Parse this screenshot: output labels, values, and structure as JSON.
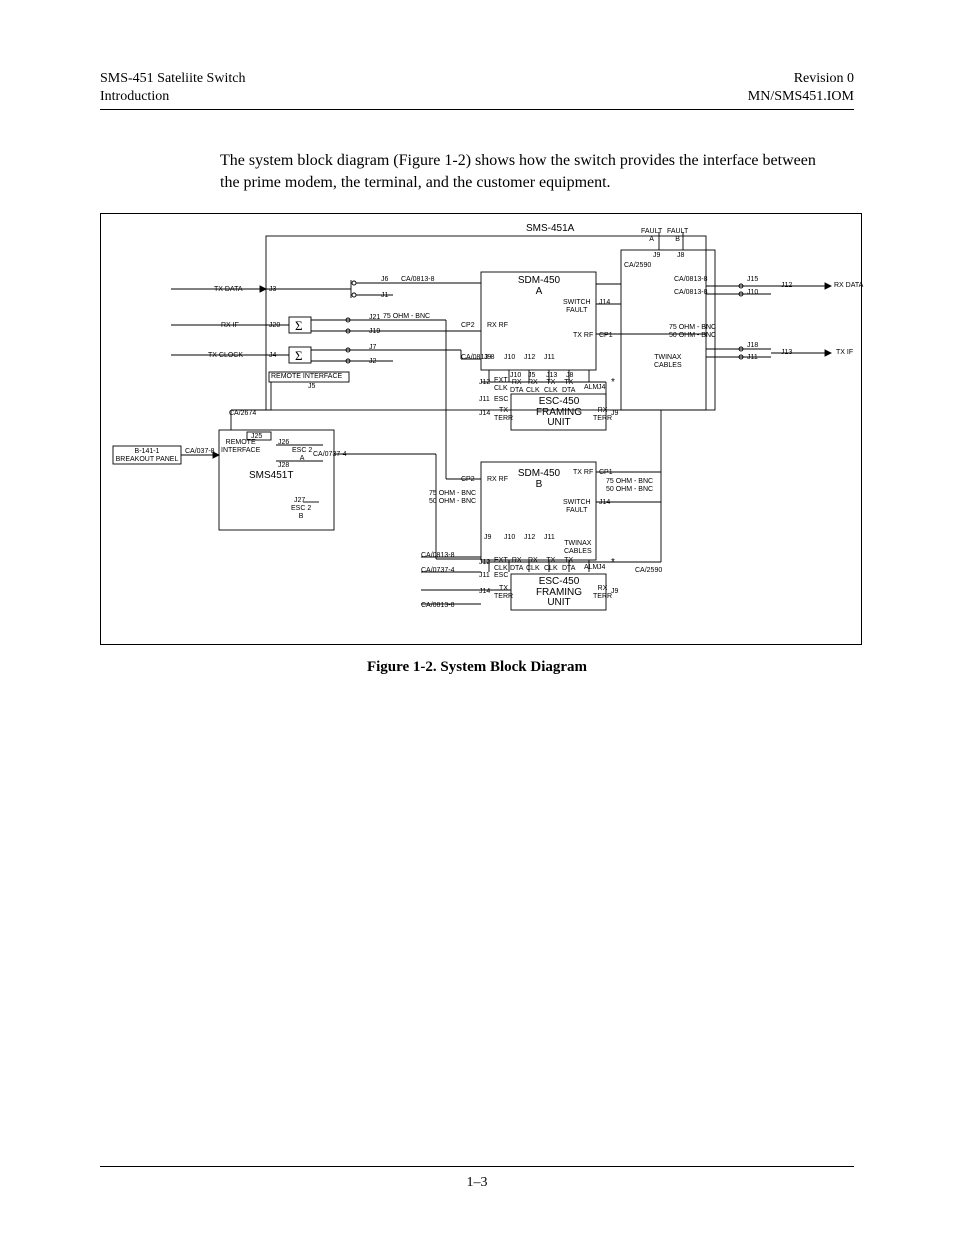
{
  "header": {
    "left1": "SMS-451 Sateliite Switch",
    "left2": "Introduction",
    "right1": "Revision 0",
    "right2": "MN/SMS451.IOM"
  },
  "body": "The system block diagram (Figure 1-2) shows how the switch provides the interface between the prime modem, the terminal, and the customer equipment.",
  "caption": "Figure 1-2.  System Block Diagram",
  "pagenum": "1–3",
  "diagram": {
    "title": "SMS-451A",
    "modemA": "SDM-450\nA",
    "modemB": "SDM-450\nB",
    "framingA": "ESC-450\nFRAMING\nUNIT",
    "framingB": "ESC-450\nFRAMING\nUNIT",
    "breakout": "B-141-1\nBREAKOUT PANEL",
    "sms451t": "SMS451T",
    "io": {
      "txData": "TX DATA",
      "rxIf": "RX IF",
      "txClock": "TX CLOCK",
      "rxData": "RX DATA",
      "txIf": "TX IF"
    },
    "fault": {
      "a": "FAULT\nA",
      "b": "FAULT\nB"
    },
    "remoteIfA": "REMOTE INTERFACE",
    "remoteIfB": "REMOTE\nINTERFACE",
    "cables": {
      "ca0813_8": "CA/0813-8",
      "ca2590": "CA/2590",
      "ca2674": "CA/2674",
      "ca0737_4": "CA/0737-4",
      "ca037_8": "CA/037-8"
    },
    "ohm": {
      "bnc": "75 OHM - BNC",
      "dual": "75 OHM - BNC\n50 OHM - BNC"
    },
    "esc2a": "ESC 2\nA",
    "esc2b": "ESC 2\nB",
    "switchFault": "SWITCH\nFAULT",
    "twinax": "TWINAX\nCABLES",
    "pins": {
      "extClk": "EXT\nCLK",
      "rxDta": "RX\nDTA",
      "rxClk": "RX\nCLK",
      "txClk": "TX\nCLK",
      "txDta": "TX\nDTA",
      "alm": "ALM",
      "esc": "ESC",
      "txTerr": "TX\nTERR",
      "rxTerr": "RX\nTERR",
      "rxRf": "RX RF",
      "txRf": "TX RF",
      "cp1": "CP1",
      "cp2": "CP2",
      "j1": "J1",
      "j2": "J2",
      "j3": "J3",
      "j4": "J4",
      "j5": "J5",
      "j6": "J6",
      "j7": "J7",
      "j8": "J8",
      "j9": "J9",
      "j10": "J10",
      "j11": "J11",
      "j12": "J12",
      "j13": "J13",
      "j14": "J14",
      "j15": "J15",
      "j18": "J18",
      "j19": "J19",
      "j20": "J20",
      "j21": "J21",
      "j25": "J25",
      "j26": "J26",
      "j27": "J27",
      "j28": "J28",
      "star": "*"
    }
  }
}
